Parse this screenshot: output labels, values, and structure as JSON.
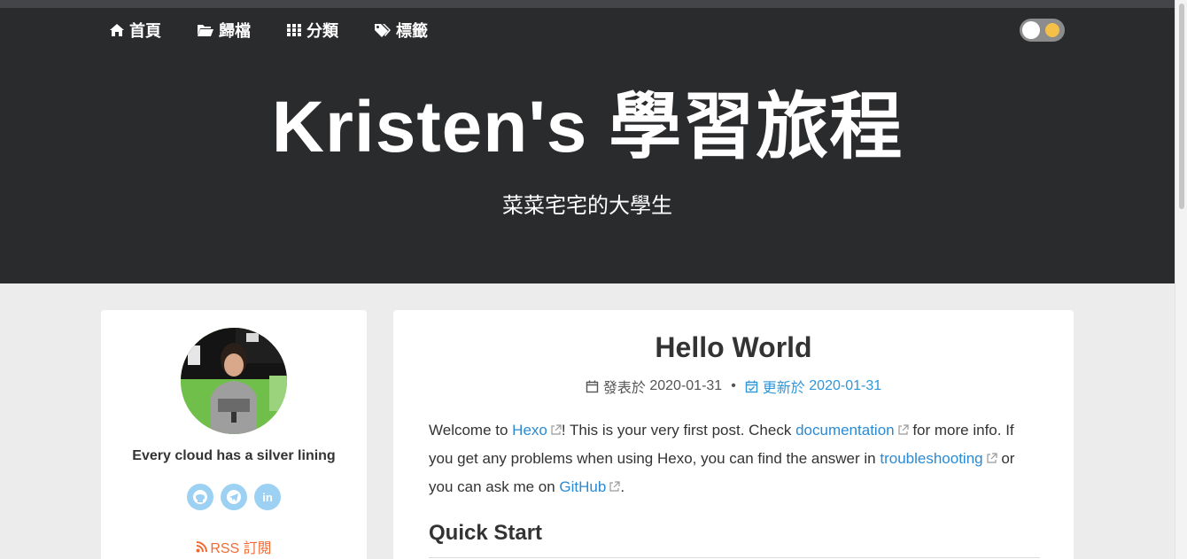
{
  "nav": {
    "items": [
      {
        "label": "首頁",
        "icon": "home-icon"
      },
      {
        "label": "歸檔",
        "icon": "folder-open-icon"
      },
      {
        "label": "分類",
        "icon": "grid-icon"
      },
      {
        "label": "標籤",
        "icon": "tags-icon"
      }
    ]
  },
  "theme_toggle": {
    "icon": "sun-icon"
  },
  "site": {
    "title": "Kristen's 學習旅程",
    "subtitle": "菜菜宅宅的大學生"
  },
  "sidebar": {
    "author_tagline": "Every cloud has a silver lining",
    "social": [
      {
        "name": "github",
        "icon": "github-icon"
      },
      {
        "name": "telegram",
        "icon": "telegram-icon"
      },
      {
        "name": "linkedin",
        "icon": "linkedin-icon",
        "glyph": "in"
      }
    ],
    "rss_label": "RSS 訂閱"
  },
  "post": {
    "title": "Hello World",
    "published_label": "發表於",
    "published_date": "2020-01-31",
    "separator": "•",
    "updated_label": "更新於",
    "updated_date": "2020-01-31",
    "body": {
      "p1_a": "Welcome to ",
      "link_hexo": "Hexo",
      "p1_b": "! This is your very first post. Check ",
      "link_docs": "documentation",
      "p1_c": " for more info. If you get any problems when using Hexo, you can find the answer in ",
      "link_troubleshooting": "troubleshooting",
      "p1_d": " or you can ask me on ",
      "link_github": "GitHub",
      "p1_e": "."
    },
    "heading": "Quick Start"
  },
  "colors": {
    "header_bg": "#2a2b2d",
    "page_bg": "#ececec",
    "link": "#2a8ad4",
    "rss": "#f06b33",
    "social_bg": "#9cd1f3"
  }
}
